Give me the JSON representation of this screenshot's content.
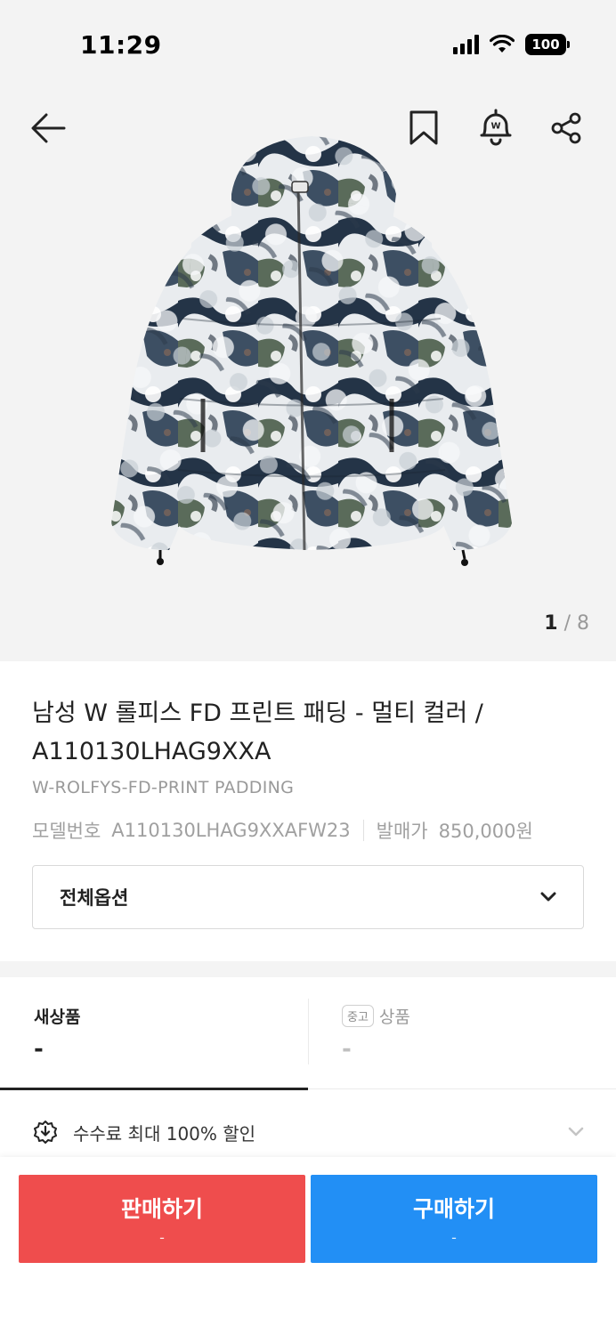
{
  "status_bar": {
    "time": "11:29",
    "battery": "100"
  },
  "hero": {
    "icons": {
      "back": "arrow-left-icon",
      "bookmark": "bookmark-icon",
      "bell": "bell-icon",
      "share": "share-icon"
    },
    "image_counter": {
      "current": "1",
      "separator": " / ",
      "total": "8"
    }
  },
  "product": {
    "title": "남성 W 롤피스 FD 프린트 패딩 - 멀티 컬러 / A110130LHAG9XXA",
    "subtitle": "W-ROLFYS-FD-PRINT PADDING",
    "model_label": "모델번호",
    "model_value": "A110130LHAG9XXAFW23",
    "release_price_label": "발매가",
    "release_price_value": "850,000원"
  },
  "options": {
    "label": "전체옵션",
    "icon": "chevron-down-icon"
  },
  "tabs": {
    "new": {
      "label": "새상품",
      "price": "-"
    },
    "used": {
      "badge": "중고",
      "label": "상품",
      "price": "-"
    }
  },
  "fee_banner": {
    "text": "수수료 최대 100% 할인",
    "icon": "discount-badge-icon"
  },
  "actions": {
    "sell": {
      "label": "판매하기",
      "price": "-",
      "color": "#ef4d4d"
    },
    "buy": {
      "label": "구매하기",
      "price": "-",
      "color": "#228ff5"
    }
  }
}
